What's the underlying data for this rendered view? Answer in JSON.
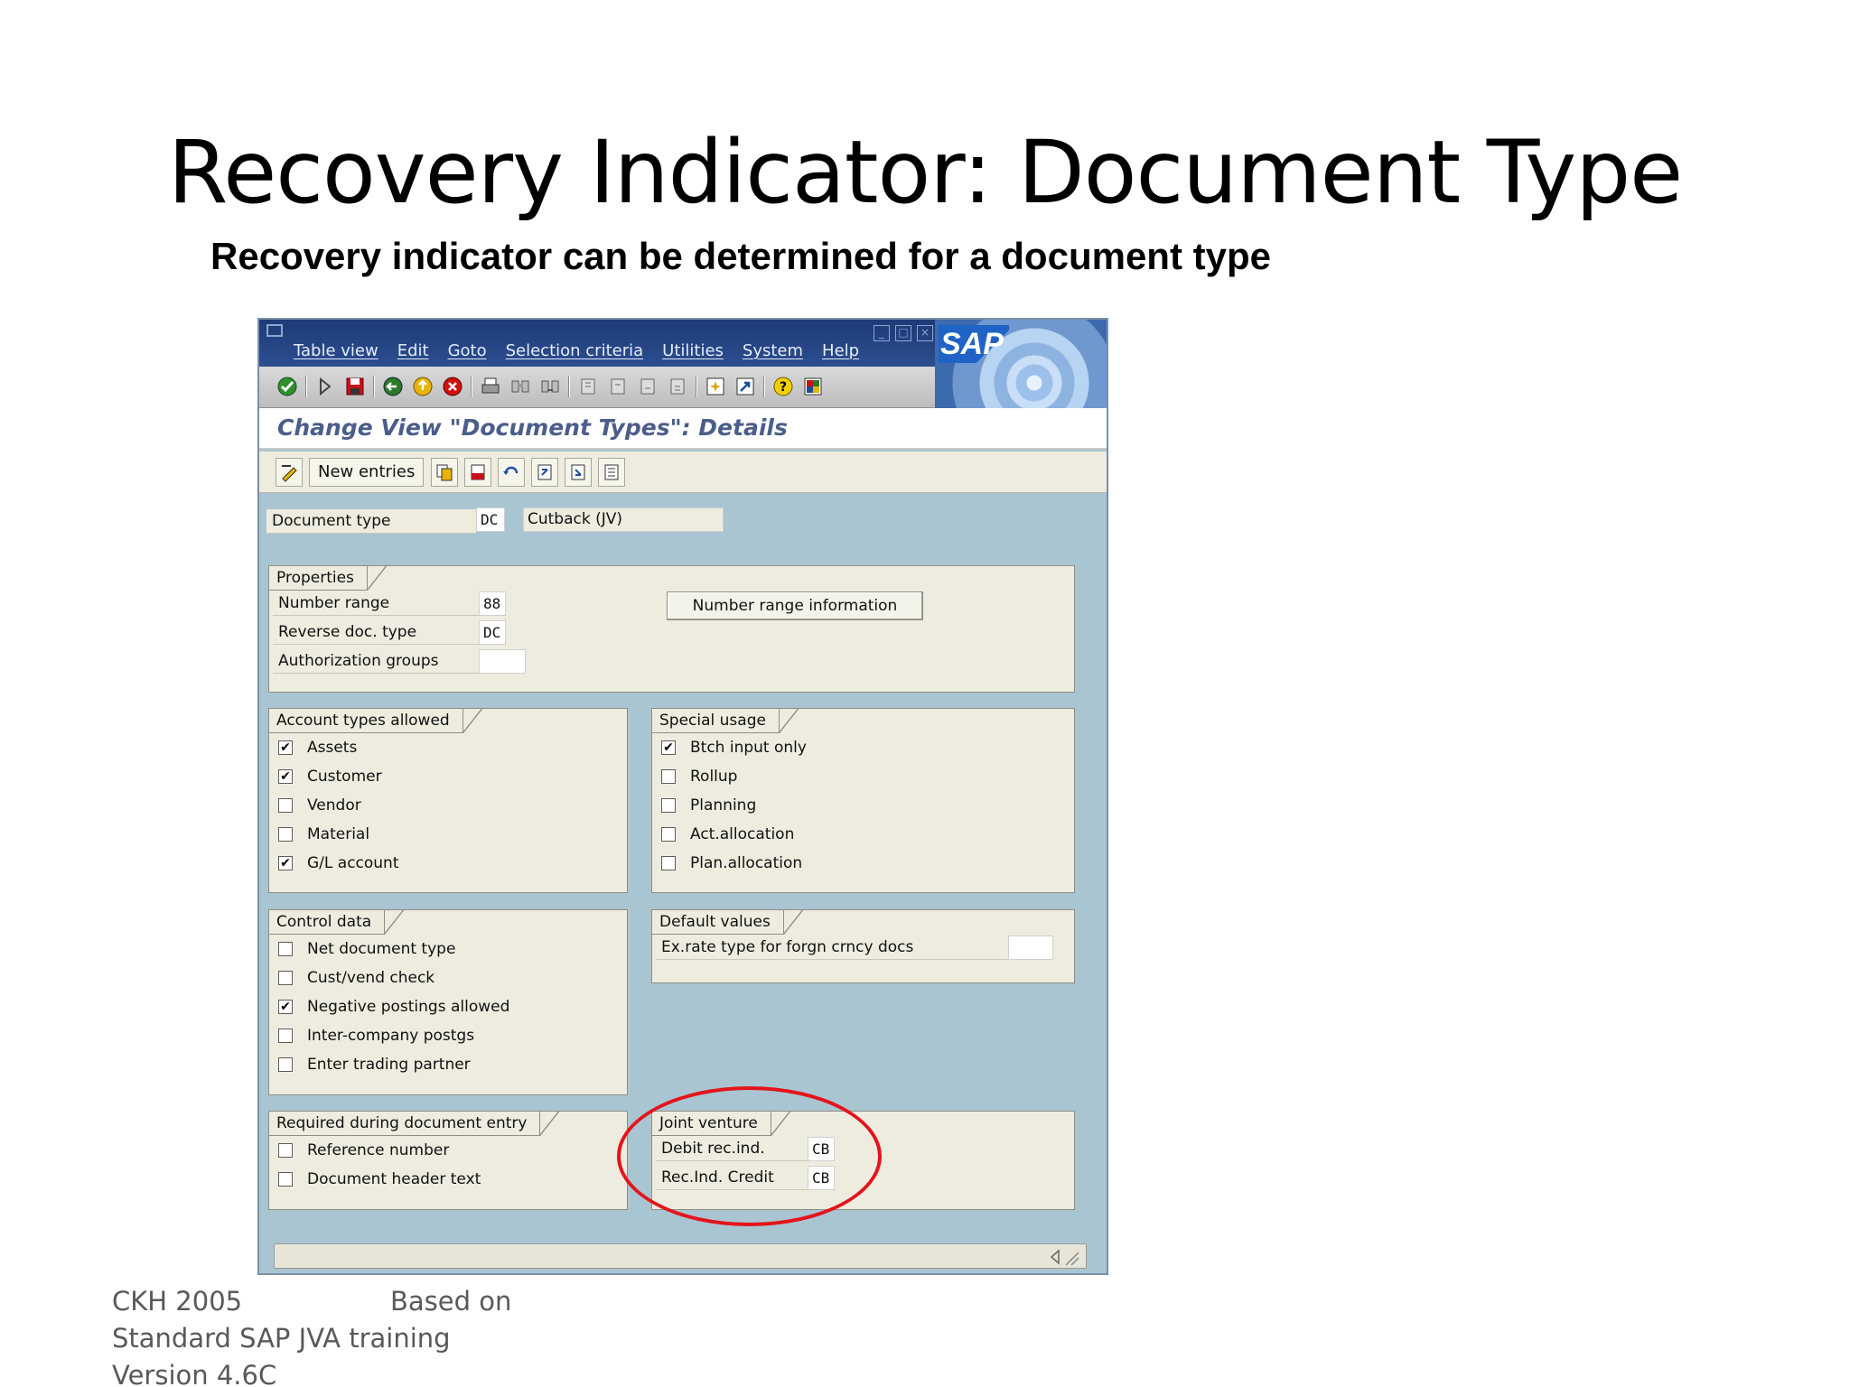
{
  "slide": {
    "title": "Recovery Indicator: Document Type",
    "subtitle": "Recovery indicator can be determined for a document type",
    "footer": {
      "author": "CKH 2005",
      "based_on": "Based on",
      "line2": "Standard SAP JVA training",
      "line3": "Version 4.6C"
    }
  },
  "sap": {
    "menu": [
      "Table view",
      "Edit",
      "Goto",
      "Selection criteria",
      "Utilities",
      "System",
      "Help"
    ],
    "logo_text": "SAP",
    "screen_title": "Change View \"Document Types\": Details",
    "app_toolbar": {
      "new_entries": "New entries"
    },
    "document_type": {
      "label": "Document type",
      "code": "DC",
      "description": "Cutback (JV)"
    },
    "properties": {
      "title": "Properties",
      "number_range_label": "Number range",
      "number_range_value": "88",
      "reverse_doc_type_label": "Reverse doc. type",
      "reverse_doc_type_value": "DC",
      "authorization_groups_label": "Authorization groups",
      "authorization_groups_value": "",
      "number_range_info_button": "Number range information"
    },
    "account_types": {
      "title": "Account types allowed",
      "items": [
        {
          "label": "Assets",
          "checked": true
        },
        {
          "label": "Customer",
          "checked": true
        },
        {
          "label": "Vendor",
          "checked": false
        },
        {
          "label": "Material",
          "checked": false
        },
        {
          "label": "G/L account",
          "checked": true
        }
      ]
    },
    "special_usage": {
      "title": "Special usage",
      "items": [
        {
          "label": "Btch input only",
          "checked": true
        },
        {
          "label": "Rollup",
          "checked": false
        },
        {
          "label": "Planning",
          "checked": false
        },
        {
          "label": "Act.allocation",
          "checked": false
        },
        {
          "label": "Plan.allocation",
          "checked": false
        }
      ]
    },
    "control_data": {
      "title": "Control data",
      "items": [
        {
          "label": "Net document type",
          "checked": false
        },
        {
          "label": "Cust/vend check",
          "checked": false
        },
        {
          "label": "Negative postings allowed",
          "checked": true
        },
        {
          "label": "Inter-company postgs",
          "checked": false
        },
        {
          "label": "Enter trading partner",
          "checked": false
        }
      ]
    },
    "default_values": {
      "title": "Default values",
      "ex_rate_label": "Ex.rate type for forgn crncy docs",
      "ex_rate_value": ""
    },
    "required_entry": {
      "title": "Required during document entry",
      "items": [
        {
          "label": "Reference number",
          "checked": false
        },
        {
          "label": "Document header text",
          "checked": false
        }
      ]
    },
    "joint_venture": {
      "title": "Joint venture",
      "debit_label": "Debit rec.ind.",
      "debit_value": "CB",
      "credit_label": "Rec.Ind. Credit",
      "credit_value": "CB"
    },
    "colors": {
      "highlight": "#e4141b",
      "screen_bg": "#a9c5d2",
      "group_bg": "#eeecdf",
      "title_text": "#4b5d8a"
    }
  }
}
